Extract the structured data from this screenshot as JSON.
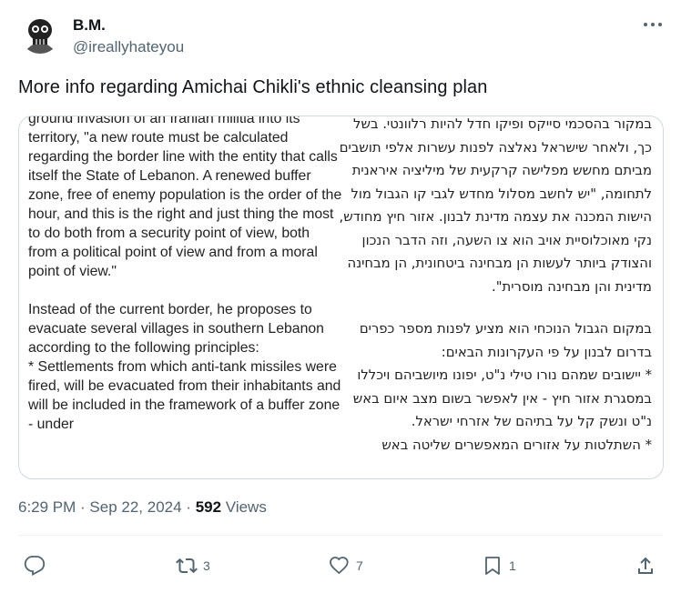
{
  "author": {
    "name": "B.M.",
    "handle": "@ireallyhateyou"
  },
  "tweet": {
    "text": "More info regarding Amichai Chikli's ethnic cleansing plan"
  },
  "image": {
    "english_paragraphs": [
      "ground invasion of an Iranian militia into its territory, \"a new route must be calculated regarding the border line with the entity that calls itself the State of Lebanon. A renewed buffer zone, free of enemy population is the order of the hour, and this is the right and just thing the most to do both from a security point of view, both from a political point of view and from a moral point of view.\"",
      "Instead of the current border, he proposes to evacuate several villages in southern Lebanon according to the following principles:\n* Settlements from which anti-tank missiles were fired, will be evacuated from their inhabitants and will be included in the framework of a buffer zone - under"
    ],
    "hebrew_paragraphs": [
      "במקור בהסכמי סייקס ופיקו חדל להיות רלוונטי. בשל כך, ולאחר שישראל נאלצה לפנות עשרות אלפי תושבים מביתם מחשש מפלישה קרקעית של מיליציה איראנית לתחומה, \"יש לחשב מסלול מחדש לגבי קו הגבול מול הישות המכנה את עצמה מדינת לבנון. אזור חיץ מחודש, נקי מאוכלוסיית אויב הוא צו השעה, וזה הדבר הנכון והצודק ביותר לעשות הן מבחינה ביטחונית, הן מבחינה מדינית והן מבחינה מוסרית\".",
      "במקום הגבול הנוכחי הוא מציע לפנות מספר כפרים בדרום לבנון על פי העקרונות הבאים:\n* יישובים שמהם נורו טילי נ\"ט, יפונו מיושביהם ויכללו במסגרת אזור חיץ - אין לאפשר בשום מצב איום באש נ\"ט ונשק קל על בתיהם של אזרחי ישראל.\n* השתלטות על אזורים המאפשרים שליטה באש"
    ]
  },
  "meta": {
    "time": "6:29 PM",
    "separator": " · ",
    "date": "Sep 22, 2024",
    "views_count": "592",
    "views_label": "Views"
  },
  "actions": {
    "replies": "",
    "reposts": "3",
    "likes": "7",
    "bookmarks": "1"
  },
  "colors": {
    "text": "#0f1419",
    "secondary": "#536471",
    "border": "#cfd9de"
  },
  "icons": [
    "more-icon",
    "reply-icon",
    "repost-icon",
    "like-icon",
    "bookmark-icon",
    "share-icon"
  ]
}
